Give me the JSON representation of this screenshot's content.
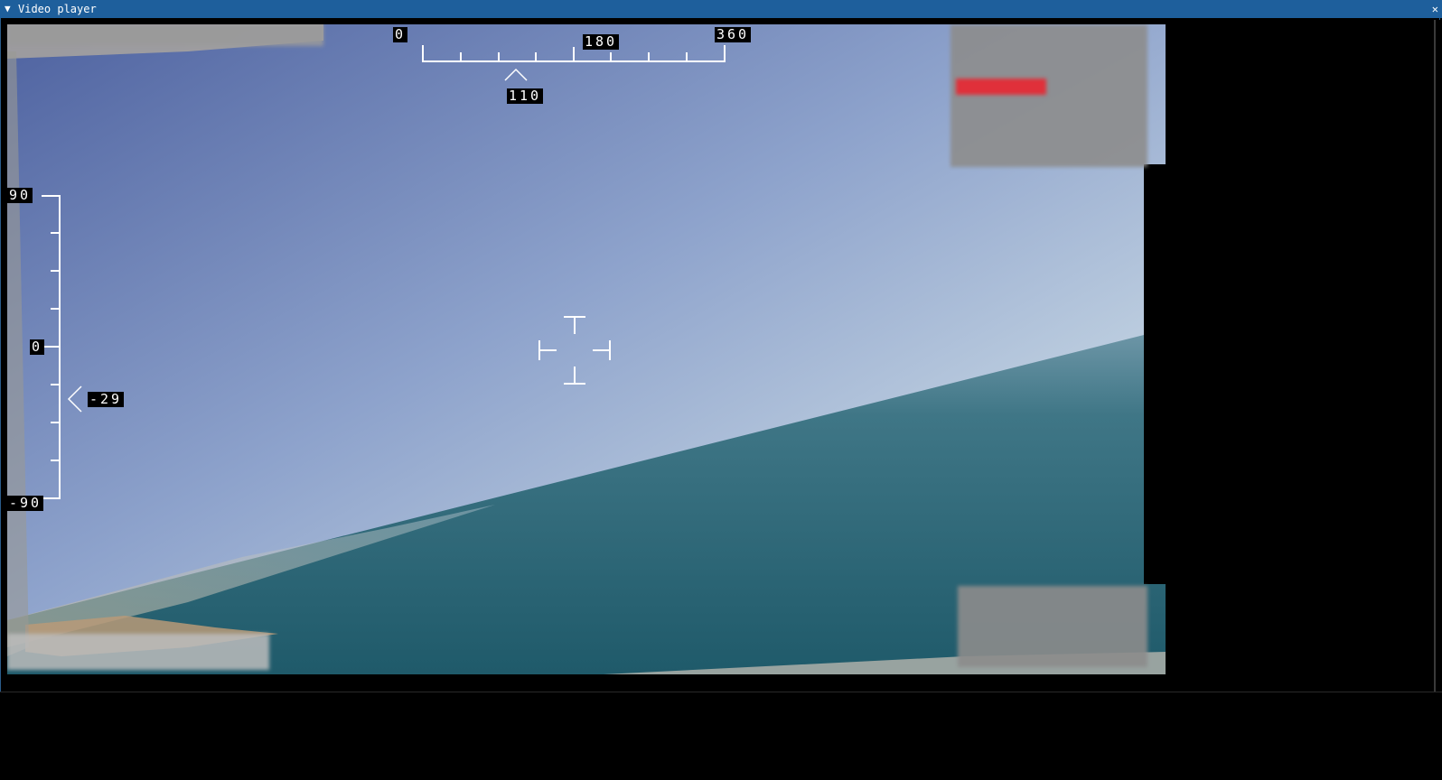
{
  "window": {
    "title": "Video player",
    "collapse_icon": "triangle-down-icon",
    "close_icon": "close-icon",
    "accent": "#1e5f9c"
  },
  "hud": {
    "heading": {
      "min_label": "0",
      "mid_label": "180",
      "max_label": "360",
      "current_label": "110",
      "min": 0,
      "max": 360,
      "current": 110
    },
    "pitch": {
      "max_label": "90",
      "zero_label": "0",
      "min_label": "-90",
      "current_label": "-29",
      "min": -90,
      "max": 90,
      "current": -29
    },
    "reticle_icon": "crosshair-icon"
  },
  "colors": {
    "sky_top": "#5b6fa6",
    "sky_horizon": "#c9d8e4",
    "sea": "#2f6a78",
    "hud": "#ffffff",
    "redaction_red": "#e0303a"
  }
}
